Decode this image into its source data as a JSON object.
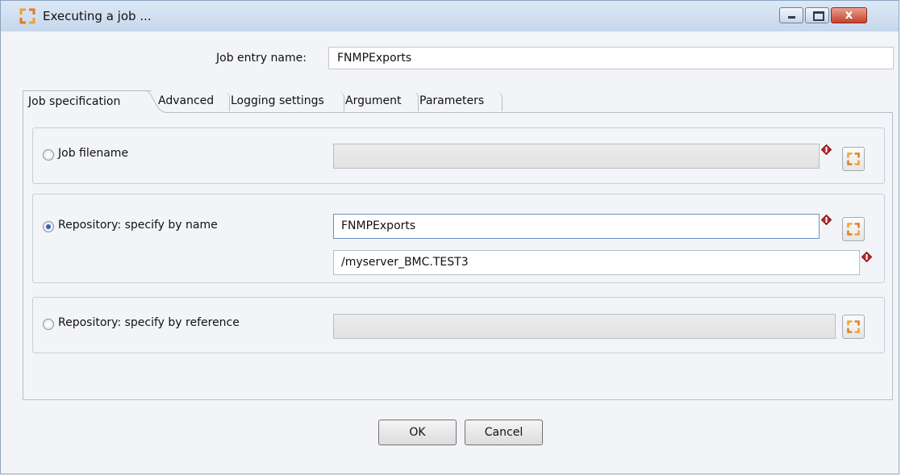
{
  "window": {
    "title": "Executing a job ...",
    "close_glyph": "x"
  },
  "entry": {
    "label": "Job entry name:",
    "value": "FNMPExports"
  },
  "tabs": [
    {
      "label": "Job specification",
      "active": true
    },
    {
      "label": "Advanced"
    },
    {
      "label": "Logging settings"
    },
    {
      "label": "Argument"
    },
    {
      "label": "Parameters"
    }
  ],
  "job_filename": {
    "label": "Job filename",
    "value": "",
    "selected": false
  },
  "repo_by_name": {
    "label": "Repository: specify by name",
    "name_value": "FNMPExports",
    "dir_value": "/myserver_BMC.TEST3",
    "selected": true
  },
  "repo_by_ref": {
    "label": "Repository: specify by reference",
    "value": "",
    "selected": false
  },
  "buttons": {
    "ok": "OK",
    "cancel": "Cancel"
  },
  "icons": {
    "app": "kettle-icon",
    "variable": "variable-diamond-icon",
    "browse": "browse-kettle-icon"
  },
  "colors": {
    "accent": "#f0a030",
    "diamond": "#c0272d",
    "titlebar": "#c6d7ec",
    "close": "#c5412c"
  }
}
